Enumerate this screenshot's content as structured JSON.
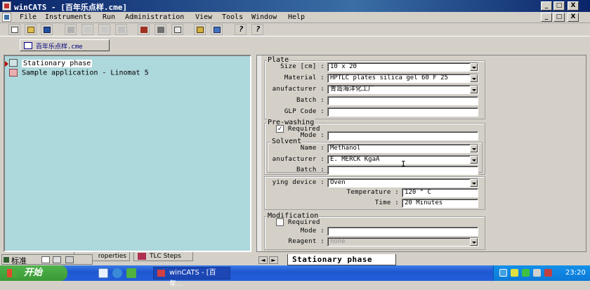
{
  "window": {
    "title": "winCATS - [百年乐点样.cme]",
    "controls": {
      "minimize": "_",
      "maximize": "□",
      "close": "X"
    }
  },
  "menubar": [
    "File",
    "Instruments",
    "Run",
    "Administration",
    "View",
    "Tools",
    "Window",
    "Help"
  ],
  "doc_tab": {
    "label": "百年乐点样.cme"
  },
  "tree": {
    "items": [
      {
        "label": "Stationary phase",
        "selected": true
      },
      {
        "label": "Sample application - Linomat 5",
        "selected": false
      }
    ]
  },
  "left_tabs": {
    "properties": "roperties",
    "tlc_steps": "TLC Steps"
  },
  "ime": {
    "label": "标准"
  },
  "plate": {
    "group_label": "Plate",
    "size_label": "Size [cm]",
    "size_value": "10 x 20",
    "material_label": "Material",
    "material_value": "HPTLC plates silica gel 60 F 25",
    "manufacturer_label": "anufacturer",
    "manufacturer_value": "青岛海洋化工厂",
    "batch_label": "Batch",
    "batch_value": "",
    "glp_label": "GLP Code",
    "glp_value": ""
  },
  "prewashing": {
    "group_label": "Pre-washing",
    "required_label": "Required",
    "required_checked": true,
    "mode_label": "Mode",
    "mode_value": "",
    "solvent_label": "Solvent",
    "name_label": "Name",
    "name_value": "Methanol",
    "manufacturer_label": "anufacturer",
    "manufacturer_value": "E. MERCK KgaA",
    "batch_label": "Batch",
    "batch_value": ""
  },
  "drying": {
    "device_label": "ying device",
    "device_value": "Oven",
    "temperature_label": "Temperature",
    "temperature_value": "120 ° C",
    "time_label": "Time",
    "time_value": "20 Minutes"
  },
  "modification": {
    "group_label": "Modification",
    "required_label": "Required",
    "required_checked": false,
    "mode_label": "Mode",
    "mode_value": "",
    "reagent_label": "Reagent",
    "reagent_value": "none"
  },
  "right_tab": {
    "label": "Stationary phase"
  },
  "taskbar": {
    "start_label": "开始",
    "task_label": "winCATS - [百年...",
    "clock": "23:20"
  }
}
